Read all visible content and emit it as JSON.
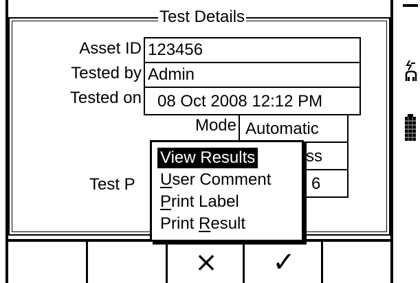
{
  "dialog": {
    "title": "Test Details"
  },
  "fields": {
    "asset_id": {
      "label": "Asset ID",
      "value": "123456"
    },
    "tested_by": {
      "label": "Tested by",
      "value": "Admin"
    },
    "tested_on": {
      "label": "Tested on",
      "value": "08 Oct 2008 12:12 PM"
    },
    "mode": {
      "label": "Mode",
      "value": "Automatic"
    },
    "status": {
      "value_fragment": "ss"
    },
    "test_period": {
      "label_fragment": "Test P",
      "value": "6"
    }
  },
  "menu": {
    "items": [
      {
        "prefix": "",
        "underline": "",
        "text": "View Results",
        "suffix": ""
      },
      {
        "prefix": "",
        "underline": "U",
        "text": "",
        "suffix": "ser Comment"
      },
      {
        "prefix": "",
        "underline": "P",
        "text": "",
        "suffix": "rint Label"
      },
      {
        "prefix": "Print ",
        "underline": "R",
        "text": "",
        "suffix": "esult"
      }
    ]
  },
  "function_keys": {
    "cancel_glyph": "×",
    "confirm_glyph": "✓"
  },
  "icons": {
    "top": "power-plug-icon",
    "bottom": "battery-icon",
    "cancel": "close-icon",
    "confirm": "checkmark-icon"
  },
  "colors": {
    "foreground": "#000000",
    "background": "#ffffff",
    "highlight": "#000000"
  }
}
